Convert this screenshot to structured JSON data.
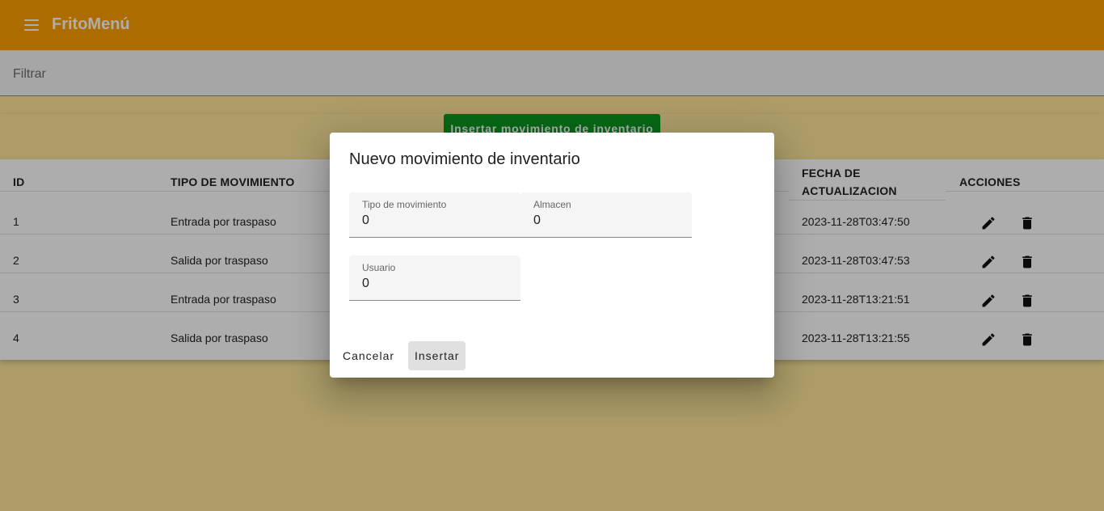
{
  "app": {
    "title": "FritoMenú",
    "menu_icon": "hamburger-menu-icon"
  },
  "filter": {
    "placeholder": "Filtrar"
  },
  "insert_button": {
    "label": "Insertar movimiento de inventario",
    "color": "#0b9a1f"
  },
  "table": {
    "columns": [
      "ID",
      "TIPO DE MOVIMIENTO",
      "FECHA DE",
      "ACTUALIZACION",
      "ACCIONES"
    ],
    "rows": [
      {
        "id": "1",
        "tipo": "Entrada por traspaso",
        "fecha": "2023-11-28T03:47:50"
      },
      {
        "id": "2",
        "tipo": "Salida por traspaso",
        "fecha": "2023-11-28T03:47:53"
      },
      {
        "id": "3",
        "tipo": "Entrada por traspaso",
        "fecha": "2023-11-28T13:21:51"
      },
      {
        "id": "4",
        "tipo": "Salida por traspaso",
        "fecha": "2023-11-28T13:21:55"
      }
    ],
    "action_icons": [
      "edit-pencil-icon",
      "delete-trash-icon"
    ]
  },
  "dialog": {
    "title": "Nuevo movimiento de inventario",
    "fields": {
      "tipo": {
        "label": "Tipo de movimiento",
        "value": "0"
      },
      "almacen": {
        "label": "Almacen",
        "value": "0"
      },
      "usuario": {
        "label": "Usuario",
        "value": "0"
      }
    },
    "cancel_label": "Cancelar",
    "insert_label": "Insertar"
  },
  "colors": {
    "toolbar": "#ffa000",
    "background": "#fde69a",
    "backdrop": "rgba(0,0,0,0.32)"
  }
}
